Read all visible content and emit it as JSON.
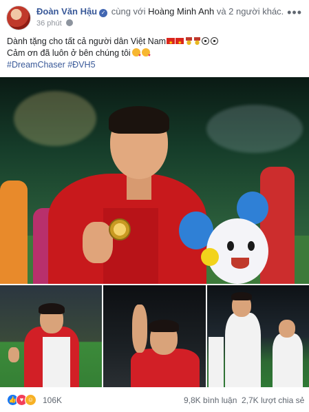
{
  "post": {
    "author": "Đoàn Văn Hậu",
    "with_prefix": "cùng với",
    "with_name": "Hoàng Minh Anh",
    "with_suffix": "và 2 người khác.",
    "time": "36 phút",
    "text_line1": "Dành tặng cho tất cả người dân Việt Nam",
    "text_line2": "Cảm ơn đã luôn ở bên chúng tôi",
    "hashtags": "#DreamChaser #ĐVH5"
  },
  "engagement": {
    "reactions": "106K",
    "comments": "9,8K bình luận",
    "shares": "2,7K lượt chia sẻ"
  },
  "icons": {
    "verified": "verified-badge-icon",
    "privacy": "globe-icon",
    "more": "more-options-icon",
    "reactions": [
      "like-icon",
      "love-icon",
      "haha-icon"
    ]
  },
  "colors": {
    "link": "#385898",
    "like": "#1877f2",
    "love": "#f33e58",
    "haha": "#f7b125"
  }
}
